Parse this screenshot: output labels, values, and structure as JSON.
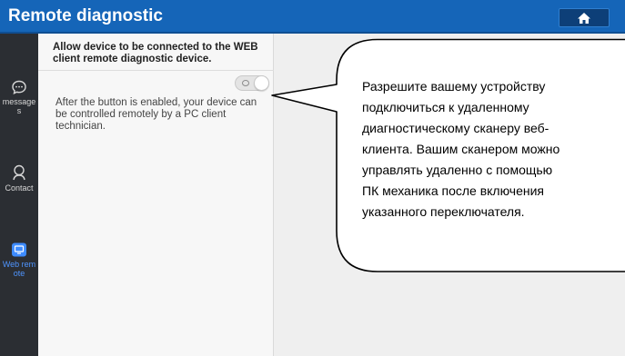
{
  "header": {
    "title": "Remote diagnostic",
    "home_icon": "home-icon"
  },
  "sidebar": {
    "items": [
      {
        "label": "message s",
        "icon": "message-icon",
        "active": false
      },
      {
        "label": "Contact",
        "icon": "contact-icon",
        "active": false
      },
      {
        "label": "Web remote",
        "icon": "web-remote-icon",
        "active": true
      }
    ]
  },
  "panel": {
    "heading": "Allow device to be connected to the WEB client remote diagnostic device.",
    "toggle_state": "off",
    "description": "After the button is enabled, your device can be controlled remotely by a PC client technician."
  },
  "callout": {
    "lines": [
      "Разрешите вашему устройству",
      "подключиться к удаленному",
      "диагностическому сканеру веб-",
      "клиента.  Вашим сканером можно",
      "управлять удаленно с помощью",
      "ПК механика после включения",
      "указанного переключателя."
    ]
  },
  "colors": {
    "titlebar": "#1565b8",
    "sidebar": "#2b2e33",
    "active_accent": "#4f95ff",
    "content_bg": "#efefef"
  }
}
